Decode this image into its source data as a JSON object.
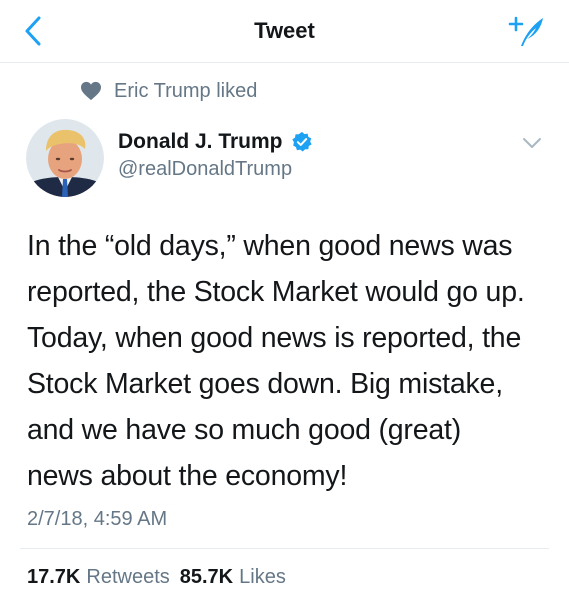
{
  "header": {
    "title": "Tweet",
    "back_icon": "chevron-left-icon",
    "compose_icon": "compose-tweet-icon",
    "accent_color": "#1da1f2"
  },
  "social_context": {
    "icon": "heart-icon",
    "text": "Eric Trump liked"
  },
  "author": {
    "name": "Donald J. Trump",
    "verified_icon": "verified-badge-icon",
    "handle": "@realDonaldTrump"
  },
  "tweet": {
    "lines": [
      "In the “old days,” when good news was",
      "reported, the Stock Market would go up.",
      "Today, when good news is reported, the",
      "Stock Market goes down. Big mistake,",
      "and we have so much good (great)",
      "news about the economy!"
    ],
    "timestamp": "2/7/18, 4:59 AM"
  },
  "stats": {
    "retweets_count": "17.7K",
    "retweets_label": "Retweets",
    "likes_count": "85.7K",
    "likes_label": "Likes"
  }
}
